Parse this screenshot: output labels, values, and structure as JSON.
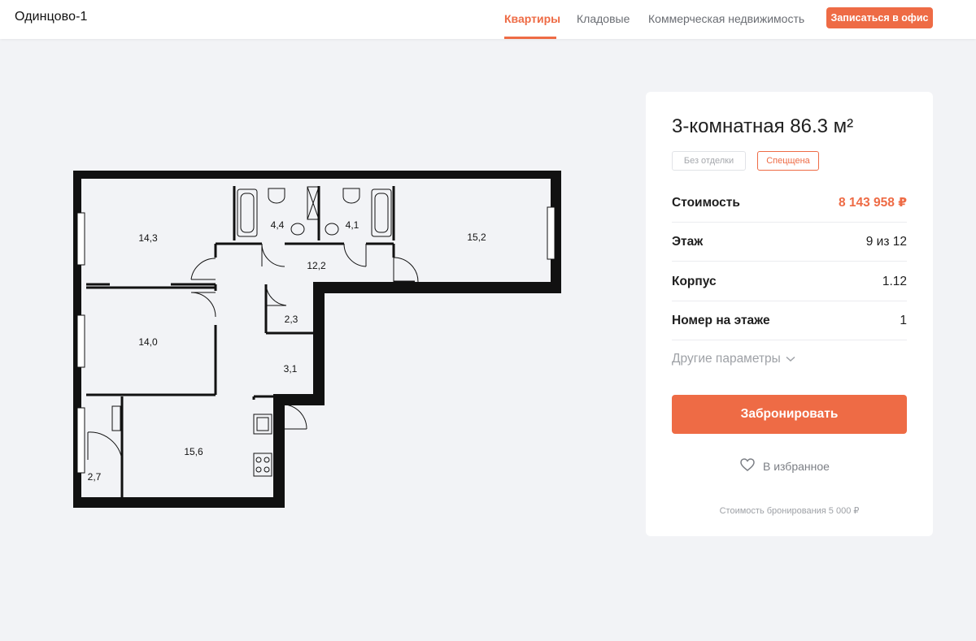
{
  "header": {
    "logo": "Одинцово-1",
    "nav": [
      {
        "label": "Квартиры",
        "active": true
      },
      {
        "label": "Кладовые",
        "active": false
      },
      {
        "label": "Коммерческая недвижимость",
        "active": false
      }
    ],
    "office_button": "Записаться в офис"
  },
  "plan": {
    "rooms": [
      "14,3",
      "4,4",
      "4,1",
      "15,2",
      "12,2",
      "14,0",
      "2,3",
      "3,1",
      "15,6",
      "2,7"
    ]
  },
  "card": {
    "title": "3-комнатная 86.3 м²",
    "tags": [
      "Без отделки",
      "Спецщена"
    ],
    "rows": [
      {
        "label": "Стоимость",
        "value": "8 143 958 ₽"
      },
      {
        "label": "Этаж",
        "value": "9 из 12"
      },
      {
        "label": "Корпус",
        "value": "1.12"
      },
      {
        "label": "Номер на этаже",
        "value": "1"
      }
    ],
    "more_params": "Другие параметры",
    "book_button": "Забронировать",
    "favorite": "В избранное",
    "booking_note": "Стоимость бронирования 5 000 ₽"
  },
  "colors": {
    "accent": "#ee6b45",
    "background": "#f2f3f6"
  }
}
